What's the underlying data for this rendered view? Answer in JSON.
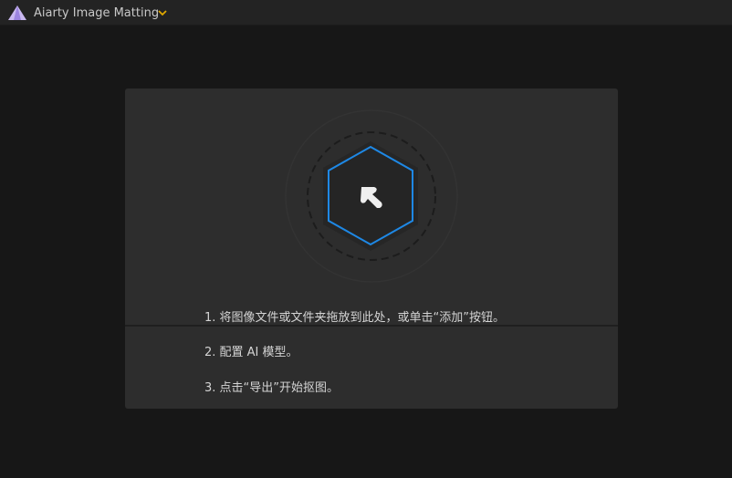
{
  "app": {
    "title": "Aiarty Image Matting",
    "logo_icon": "aiarty-logo-icon",
    "menu_icon": "chevron-down-icon"
  },
  "colors": {
    "accent": "#1e88e5",
    "chevron": "#e0a800"
  },
  "drop_zone": {
    "icon": "upload-arrow-icon",
    "steps": [
      "1. 将图像文件或文件夹拖放到此处，或单击“添加”按钮。",
      "2. 配置 AI 模型。",
      "3. 点击“导出”开始抠图。"
    ]
  }
}
